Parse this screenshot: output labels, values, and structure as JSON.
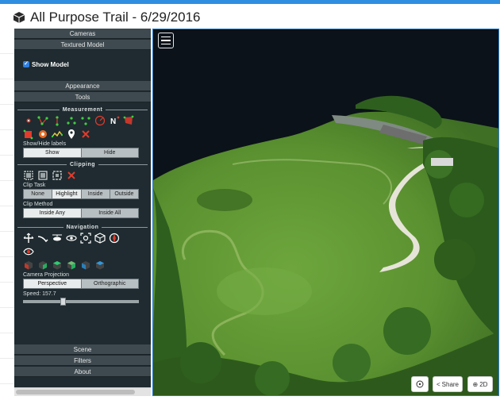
{
  "header": {
    "title": "All Purpose Trail - 6/29/2016"
  },
  "sidebar": {
    "sections": {
      "cameras": "Cameras",
      "textured_model": "Textured Model",
      "appearance": "Appearance",
      "tools": "Tools",
      "scene": "Scene",
      "filters": "Filters",
      "about": "About"
    },
    "show_model": {
      "label": "Show Model",
      "checked": true
    },
    "measurement": {
      "title": "Measurement",
      "tools": [
        "point-icon",
        "distance-icon",
        "height-icon",
        "circle-icon",
        "azimuth-icon",
        "area-icon",
        "volume-icon",
        "sphere-volume-icon",
        "profile-icon",
        "annotation-icon",
        "remove-measurements-icon",
        "angle-icon"
      ],
      "labels_caption": "Show/Hide labels",
      "show_label": "Show",
      "hide_label": "Hide"
    },
    "clipping": {
      "title": "Clipping",
      "clip_task_label": "Clip Task",
      "clip_task_options": [
        "None",
        "Highlight",
        "Inside",
        "Outside"
      ],
      "clip_task_selected": "Highlight",
      "clip_method_label": "Clip Method",
      "clip_method_options": [
        "Inside Any",
        "Inside All"
      ],
      "clip_method_selected": "Inside Any"
    },
    "navigation": {
      "title": "Navigation",
      "camera_projection_label": "Camera Projection",
      "perspective_label": "Perspective",
      "orthographic_label": "Orthographic",
      "speed_label": "Speed: 157.7",
      "speed_fraction": 0.32
    }
  },
  "viewer": {
    "share_label": "Share",
    "mode_label": "2D"
  },
  "colors": {
    "accent": "#2f8ee0",
    "sidebar_bg": "#1f2b30",
    "section_header": "#3e4a50",
    "grass": "#4f8a2e",
    "water": "#0b1219"
  }
}
